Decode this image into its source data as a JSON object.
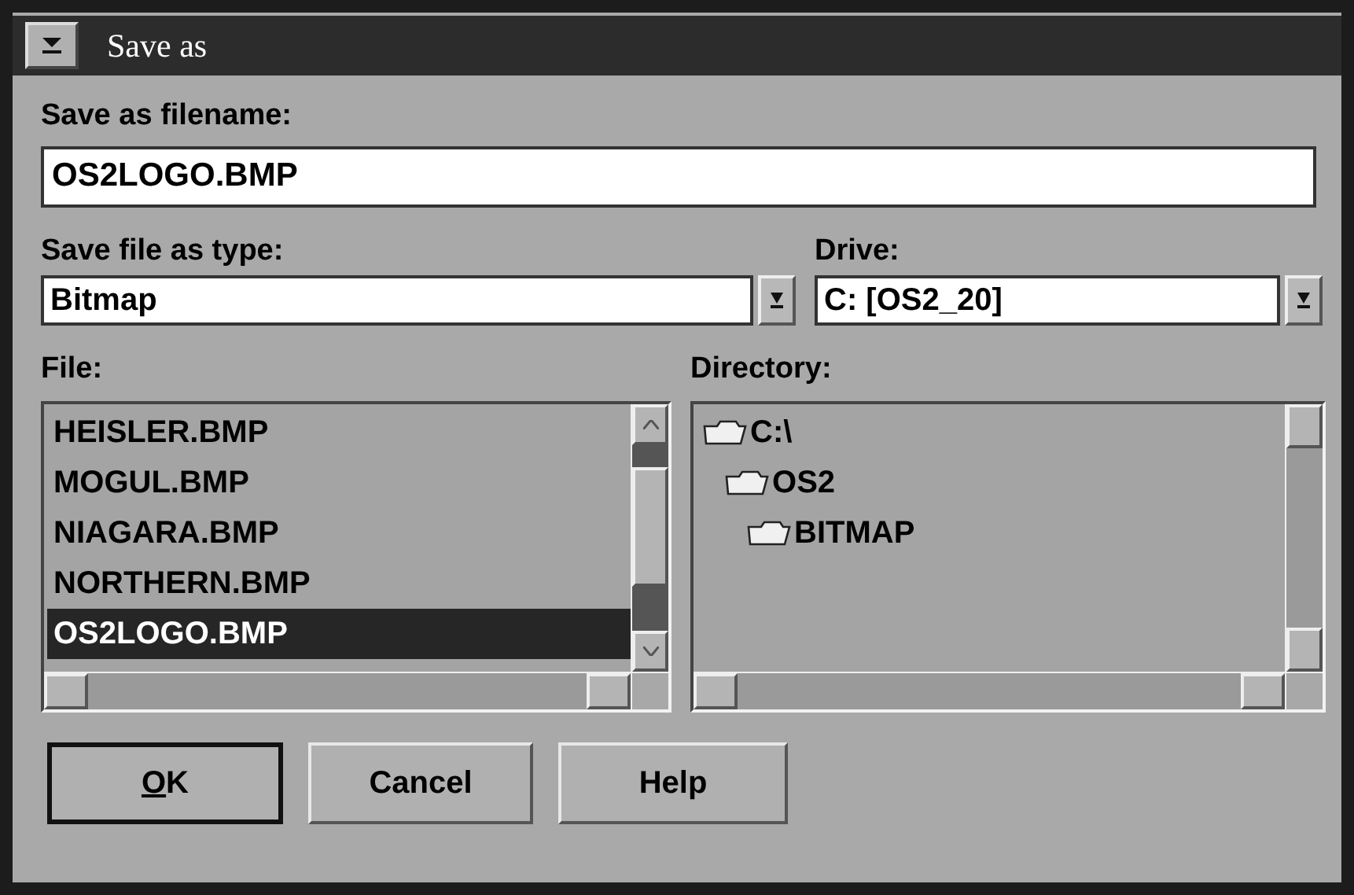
{
  "window": {
    "title": "Save as"
  },
  "filename": {
    "label": "Save as filename:",
    "value": "OS2LOGO.BMP"
  },
  "file_type": {
    "label": "Save file as type:",
    "value": "Bitmap"
  },
  "drive": {
    "label": "Drive:",
    "value": "C:  [OS2_20]"
  },
  "file_list": {
    "label": "File:",
    "items": [
      {
        "name": "HEISLER.BMP",
        "selected": false
      },
      {
        "name": "MOGUL.BMP",
        "selected": false
      },
      {
        "name": "NIAGARA.BMP",
        "selected": false
      },
      {
        "name": "NORTHERN.BMP",
        "selected": false
      },
      {
        "name": "OS2LOGO.BMP",
        "selected": true
      }
    ]
  },
  "directory": {
    "label": "Directory:",
    "items": [
      {
        "name": "C:\\",
        "children": [
          {
            "name": "OS2",
            "children": [
              {
                "name": "BITMAP"
              }
            ]
          }
        ]
      }
    ]
  },
  "buttons": [
    {
      "label": "OK",
      "underline_first": true,
      "default": true
    },
    {
      "label": "Cancel",
      "underline_first": false,
      "default": false
    },
    {
      "label": "Help",
      "underline_first": false,
      "default": false
    }
  ]
}
